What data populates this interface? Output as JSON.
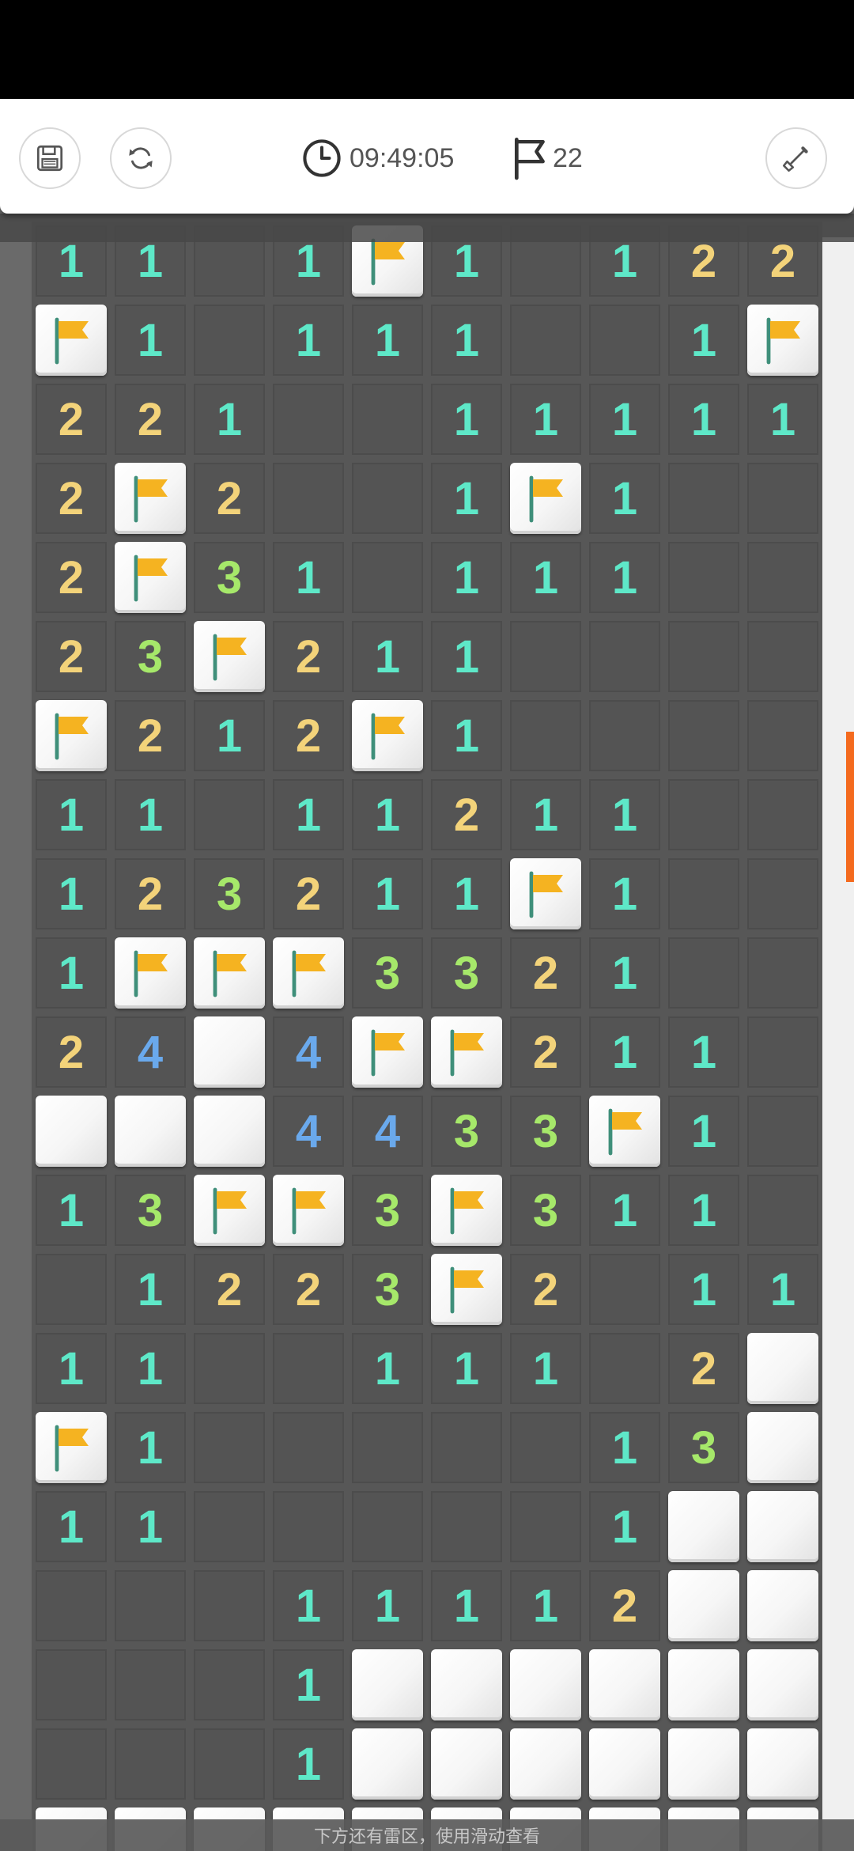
{
  "header": {
    "time": "09:49:05",
    "flag_count": "22"
  },
  "icons": {
    "save": "save-icon",
    "restart": "refresh-icon",
    "timer": "clock-icon",
    "flag": "flag-icon",
    "tool": "shovel-icon"
  },
  "colors": {
    "n1": "#5ee8c8",
    "n2": "#f3d37a",
    "n3": "#a6e86a",
    "n4": "#6aa9ec",
    "flag": "#f5b321",
    "scroll_accent": "#f46a1e"
  },
  "board": {
    "legend": "digit = revealed number, . = revealed empty, F = flagged, H = unrevealed",
    "rows": [
      "11.1F1.122",
      "F1.111..1F",
      "221..11111",
      "2F2..1F1..",
      "2F31.111..",
      "23F211....",
      "F212F1....",
      "11.11211..",
      "123211F1..",
      "1FFF3321..",
      "24H4FF211.",
      "HHH4433F1.",
      "13FF3F311.",
      ".1223F2.11",
      "11..111.2H",
      "F1.....13H",
      "11.....1HH",
      "...11112HH",
      "...1HHHHHH",
      "...1HHHHHH",
      "HHHHHHHHHH"
    ]
  },
  "footer": {
    "hint": "下方还有雷区，使用滑动查看"
  }
}
